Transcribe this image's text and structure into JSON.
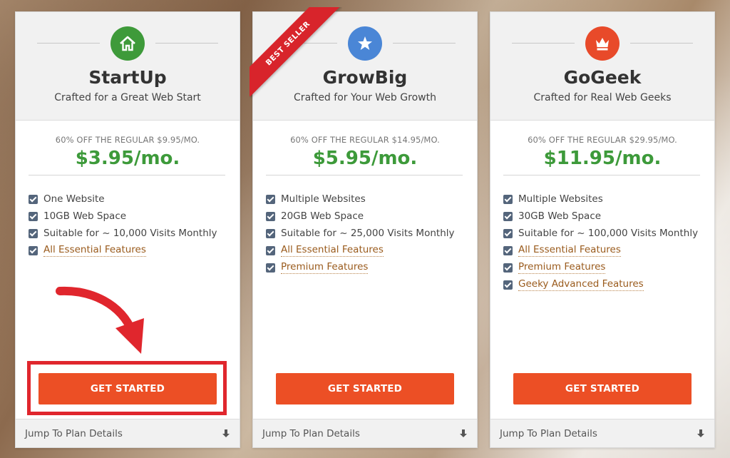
{
  "plans": [
    {
      "name": "StartUp",
      "subtitle": "Crafted for a Great Web Start",
      "icon": "home-icon",
      "icon_color": "#3e9a3a",
      "regular": "60% OFF THE REGULAR $9.95/MO.",
      "price": "$3.95/mo.",
      "features": [
        {
          "text": "One Website"
        },
        {
          "text": "10GB Web Space"
        },
        {
          "text": "Suitable for ~ 10,000 Visits Monthly"
        },
        {
          "text": "All Essential Features",
          "link": true
        }
      ],
      "cta": "GET STARTED",
      "footer": "Jump To Plan Details"
    },
    {
      "name": "GrowBig",
      "subtitle": "Crafted for Your Web Growth",
      "icon": "star-icon",
      "icon_color": "#4a86d6",
      "badge": "BEST SELLER",
      "regular": "60% OFF THE REGULAR $14.95/MO.",
      "price": "$5.95/mo.",
      "features": [
        {
          "text": "Multiple Websites"
        },
        {
          "text": "20GB Web Space"
        },
        {
          "text": "Suitable for ~ 25,000 Visits Monthly"
        },
        {
          "text": "All Essential Features",
          "link": true
        },
        {
          "text": "Premium Features",
          "link": true
        }
      ],
      "cta": "GET STARTED",
      "footer": "Jump To Plan Details"
    },
    {
      "name": "GoGeek",
      "subtitle": "Crafted for Real Web Geeks",
      "icon": "crown-icon",
      "icon_color": "#e84a2a",
      "regular": "60% OFF THE REGULAR $29.95/MO.",
      "price": "$11.95/mo.",
      "features": [
        {
          "text": "Multiple Websites"
        },
        {
          "text": "30GB Web Space"
        },
        {
          "text": "Suitable for ~ 100,000 Visits Monthly"
        },
        {
          "text": "All Essential Features",
          "link": true
        },
        {
          "text": "Premium Features",
          "link": true
        },
        {
          "text": "Geeky Advanced Features",
          "link": true
        }
      ],
      "cta": "GET STARTED",
      "footer": "Jump To Plan Details"
    }
  ],
  "colors": {
    "accent": "#ec4f25",
    "price_green": "#3d9a3a",
    "annotation_red": "#e0262d"
  }
}
